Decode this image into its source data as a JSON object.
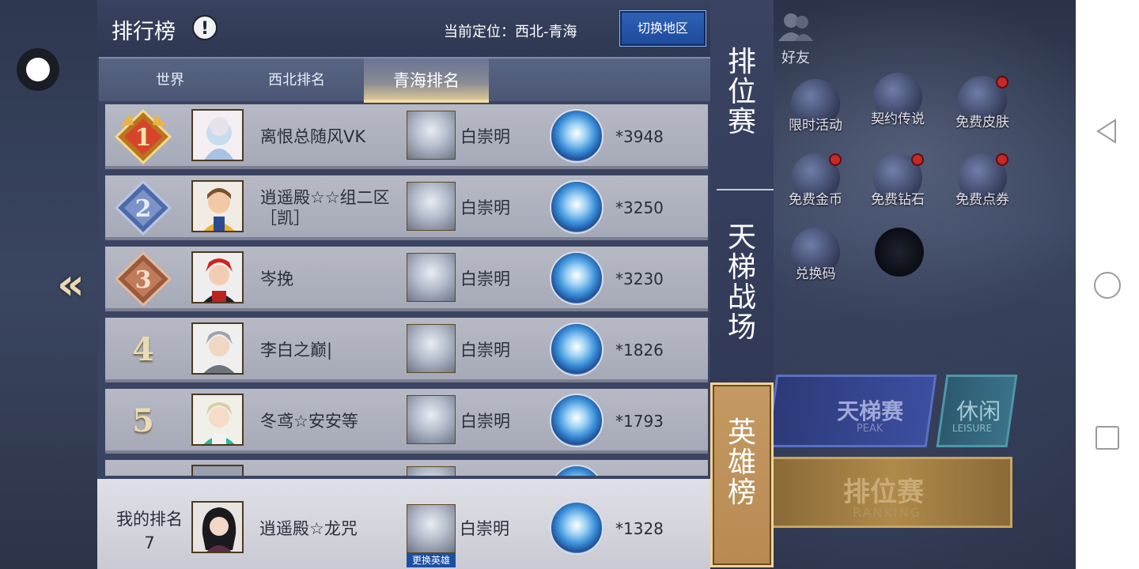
{
  "header": {
    "title": "排行榜",
    "location_label": "当前定位：西北-青海",
    "switch_region_button": "切换地区"
  },
  "tabs": [
    {
      "label": "世界",
      "active": false
    },
    {
      "label": "西北排名",
      "active": false
    },
    {
      "label": "青海排名",
      "active": true
    }
  ],
  "rows": [
    {
      "rank": "1",
      "name": "离恨总随风VK",
      "hero": "白崇明",
      "score": "*3948"
    },
    {
      "rank": "2",
      "name": "逍遥殿☆☆组二区［凯］",
      "hero": "白崇明",
      "score": "*3250"
    },
    {
      "rank": "3",
      "name": "岑挽",
      "hero": "白崇明",
      "score": "*3230"
    },
    {
      "rank": "4",
      "name": "李白之巅|",
      "hero": "白崇明",
      "score": "*1826"
    },
    {
      "rank": "5",
      "name": "冬鸢☆安安等",
      "hero": "白崇明",
      "score": "*1793"
    }
  ],
  "my_rank": {
    "label": "我的排名",
    "rank": "7",
    "name": "逍遥殿☆龙咒",
    "hero": "白崇明",
    "score": "*1328",
    "change_hero_label": "更换英雄"
  },
  "category_tabs": [
    {
      "label": "排位赛",
      "active": false
    },
    {
      "label": "天梯战场",
      "active": false
    },
    {
      "label": "英雄榜",
      "active": true
    }
  ],
  "background_menu": {
    "friends": "好友",
    "items": [
      "限时活动",
      "契约传说",
      "免费皮肤",
      "免费金币",
      "免费钻石",
      "免费点券",
      "兑换码"
    ],
    "peak_title": "天梯赛",
    "peak_sub": "PEAK",
    "leisure_title": "休闲",
    "leisure_sub": "LEISURE",
    "ranking_title": "排位赛",
    "ranking_sub": "RANKING"
  },
  "colors": {
    "gold": "#c49a62",
    "medal_blue": "#3a8fd8",
    "panel": "#3a4462"
  }
}
